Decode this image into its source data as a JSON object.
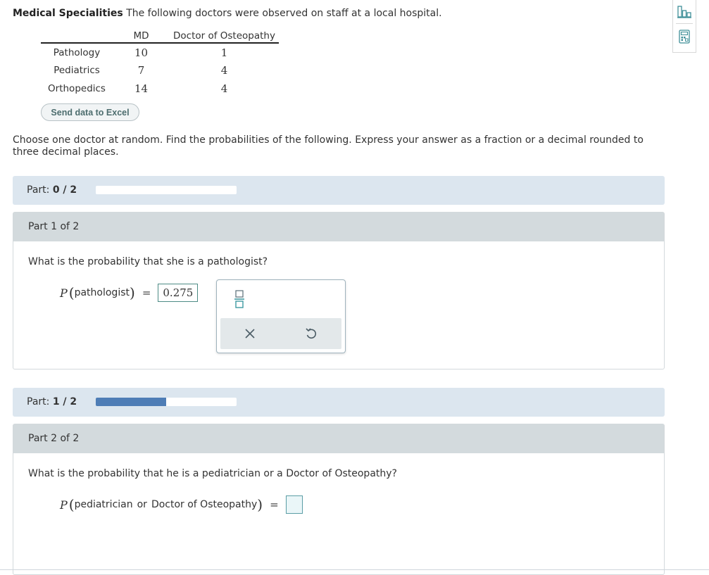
{
  "intro": {
    "title": "Medical Specialities",
    "text": "The following doctors were observed on staff at a local hospital."
  },
  "table": {
    "columns": [
      "MD",
      "Doctor of Osteopathy"
    ],
    "rows": [
      {
        "label": "Pathology",
        "md": "10",
        "do": "1"
      },
      {
        "label": "Pediatrics",
        "md": "7",
        "do": "4"
      },
      {
        "label": "Orthopedics",
        "md": "14",
        "do": "4"
      }
    ]
  },
  "excel_button": "Send data to Excel",
  "instructions": "Choose one doctor at random. Find the probabilities of the following. Express your answer as a fraction or a decimal rounded to three decimal places.",
  "progress1": {
    "label": "Part:",
    "value": "0 / 2",
    "fraction": 0.0
  },
  "part1": {
    "heading": "Part 1 of 2",
    "question": "What is the probability that she is a pathologist?",
    "P": "P",
    "event": "pathologist",
    "answer": "0.275"
  },
  "progress2": {
    "label": "Part:",
    "value": "1 / 2",
    "fraction": 0.5
  },
  "part2": {
    "heading": "Part 2 of 2",
    "question": "What is the probability that he is a pediatrician or a Doctor of Osteopathy?",
    "P": "P",
    "event_a": "pediatrician",
    "event_or": "or",
    "event_b": "Doctor of Osteopathy",
    "answer": ""
  },
  "palette": {
    "icons": [
      "fraction-icon",
      "clear-icon",
      "undo-icon"
    ]
  },
  "rail": {
    "icons": [
      "bar-chart-icon",
      "calculator-icon"
    ]
  },
  "colors": {
    "accent": "#4e7db6",
    "part_bar": "#dce6ef",
    "part_header": "#d3dadd",
    "input_border": "#4d8b85"
  }
}
